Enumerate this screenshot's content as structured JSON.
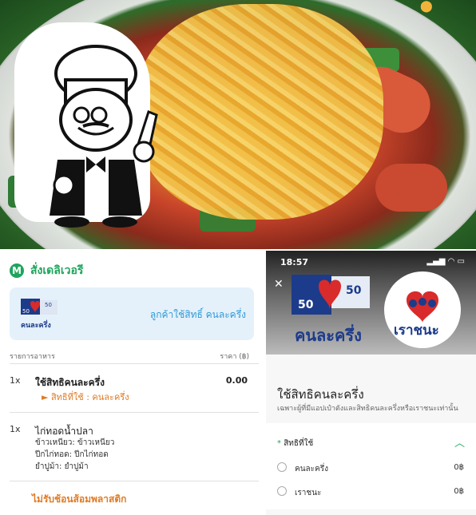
{
  "deliver": {
    "title": "สั่งเดลิเวอรี",
    "promo_text": "ลูกค้าใช้สิทธิ์ คนละครึ่ง",
    "col_item": "รายการอาหาร",
    "col_price": "ราคา (฿)",
    "items": [
      {
        "qty": "1x",
        "name": "ใช้สิทธิคนละครึ่ง",
        "price": "0.00",
        "sub": "► สิทธิที่ใช้ : คนละครึ่ง"
      },
      {
        "qty": "1x",
        "name": "ไก่ทอดน้ำปลา",
        "opt1": "ข้าวเหนียว: ข้าวเหนียว",
        "opt2": "ปีกไก่ทอด: ปีกไก่ทอด",
        "opt3": "ยำปูม้า: ยำปูม้า"
      }
    ],
    "no_spoon": "ไม่รับช้อนส้อมพลาสติก"
  },
  "phone": {
    "time": "18:57",
    "logo1": "คนละครึ่ง",
    "logo2": "เราชนะ",
    "sheet_title": "ใช้สิทธิคนละครึ่ง",
    "sheet_sub": "เฉพาะผู้ที่มีแอปเป๋าตังและสิทธิคนละครึ่งหรือเราชนะเท่านั้น",
    "card_header": "สิทธิที่ใช้",
    "options": [
      {
        "label": "คนละครึ่ง",
        "price": "0฿"
      },
      {
        "label": "เราชนะ",
        "price": "0฿"
      }
    ]
  },
  "colors": {
    "green": "#1ea55c",
    "orange": "#e07b24",
    "blue": "#2e9ad6",
    "navy": "#1c3b8a"
  }
}
